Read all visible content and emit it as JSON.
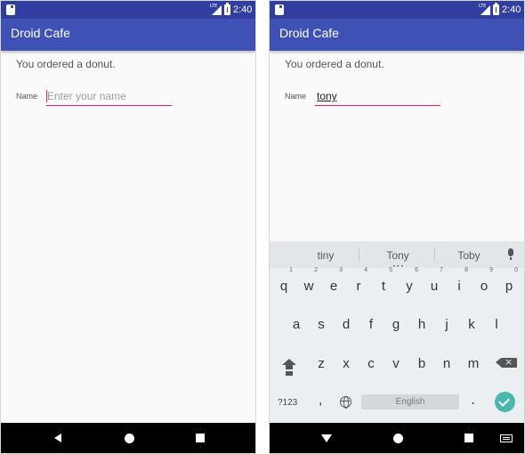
{
  "status_bar": {
    "time": "2:40",
    "network": "LTE"
  },
  "app": {
    "title": "Droid Cafe",
    "primary_color": "#3f51b5",
    "status_color": "#303f9f",
    "accent_color": "#e91e63"
  },
  "order": {
    "message": "You ordered a donut."
  },
  "name_field": {
    "label": "Name",
    "placeholder": "Enter your name",
    "value": "tony"
  },
  "keyboard": {
    "suggestions": [
      "tiny",
      "Tony",
      "Toby"
    ],
    "row1": [
      {
        "key": "q",
        "hint": "1"
      },
      {
        "key": "w",
        "hint": "2"
      },
      {
        "key": "e",
        "hint": "3"
      },
      {
        "key": "r",
        "hint": "4"
      },
      {
        "key": "t",
        "hint": "5"
      },
      {
        "key": "y",
        "hint": "6"
      },
      {
        "key": "u",
        "hint": "7"
      },
      {
        "key": "i",
        "hint": "8"
      },
      {
        "key": "o",
        "hint": "9"
      },
      {
        "key": "p",
        "hint": "0"
      }
    ],
    "row2": [
      "a",
      "s",
      "d",
      "f",
      "g",
      "h",
      "j",
      "k",
      "l"
    ],
    "row3": [
      "z",
      "x",
      "c",
      "v",
      "b",
      "n",
      "m"
    ],
    "symbols_label": "?123",
    "comma_label": ",",
    "space_label": "English",
    "period_label": ".",
    "enter_color": "#4db6ac"
  },
  "icons": {
    "status_left": "notification-icon",
    "signal": "signal-icon",
    "battery": "battery-icon",
    "nav_back": "back-icon",
    "nav_home": "home-icon",
    "nav_recents": "recents-icon",
    "nav_keyboard": "keyboard-switch-icon",
    "mic": "mic-icon",
    "shift": "shift-icon",
    "backspace": "backspace-icon",
    "globe": "globe-icon",
    "enter": "check-icon"
  }
}
